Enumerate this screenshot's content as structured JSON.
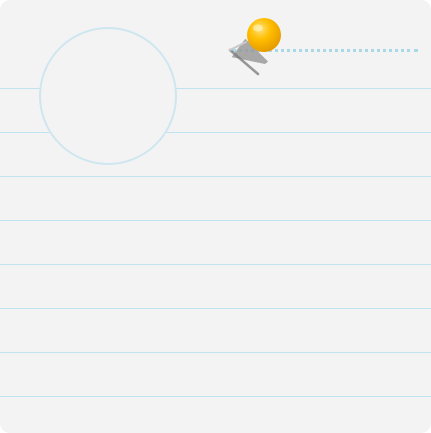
{
  "colors": {
    "card_background": "#f3f3f3",
    "ruled_line": "#bfe3ef",
    "circle_border": "#cfe6f0",
    "circle_fill": "#f3f3f3",
    "dotted_line": "#a9d8e8",
    "pin_head": "#ffbe00",
    "pin_needle": "#9a9a9a"
  },
  "icons": {
    "pin": "push-pin-icon"
  }
}
